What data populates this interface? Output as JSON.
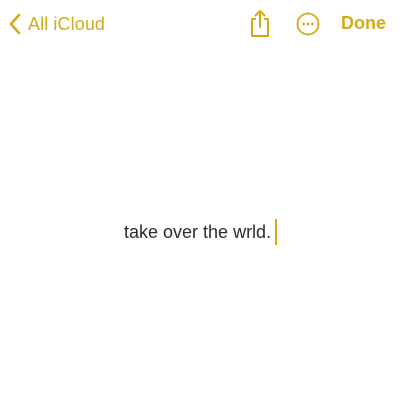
{
  "nav": {
    "back_label": "All iCloud",
    "done_label": "Done",
    "back_icon": "chevron-left-icon",
    "share_icon": "share-icon",
    "more_icon": "ellipsis-circle-icon"
  },
  "note": {
    "text": "take over the wrld."
  },
  "colors": {
    "accent": "#d6a919",
    "text": "#2b2b2b",
    "background": "#ffffff"
  }
}
